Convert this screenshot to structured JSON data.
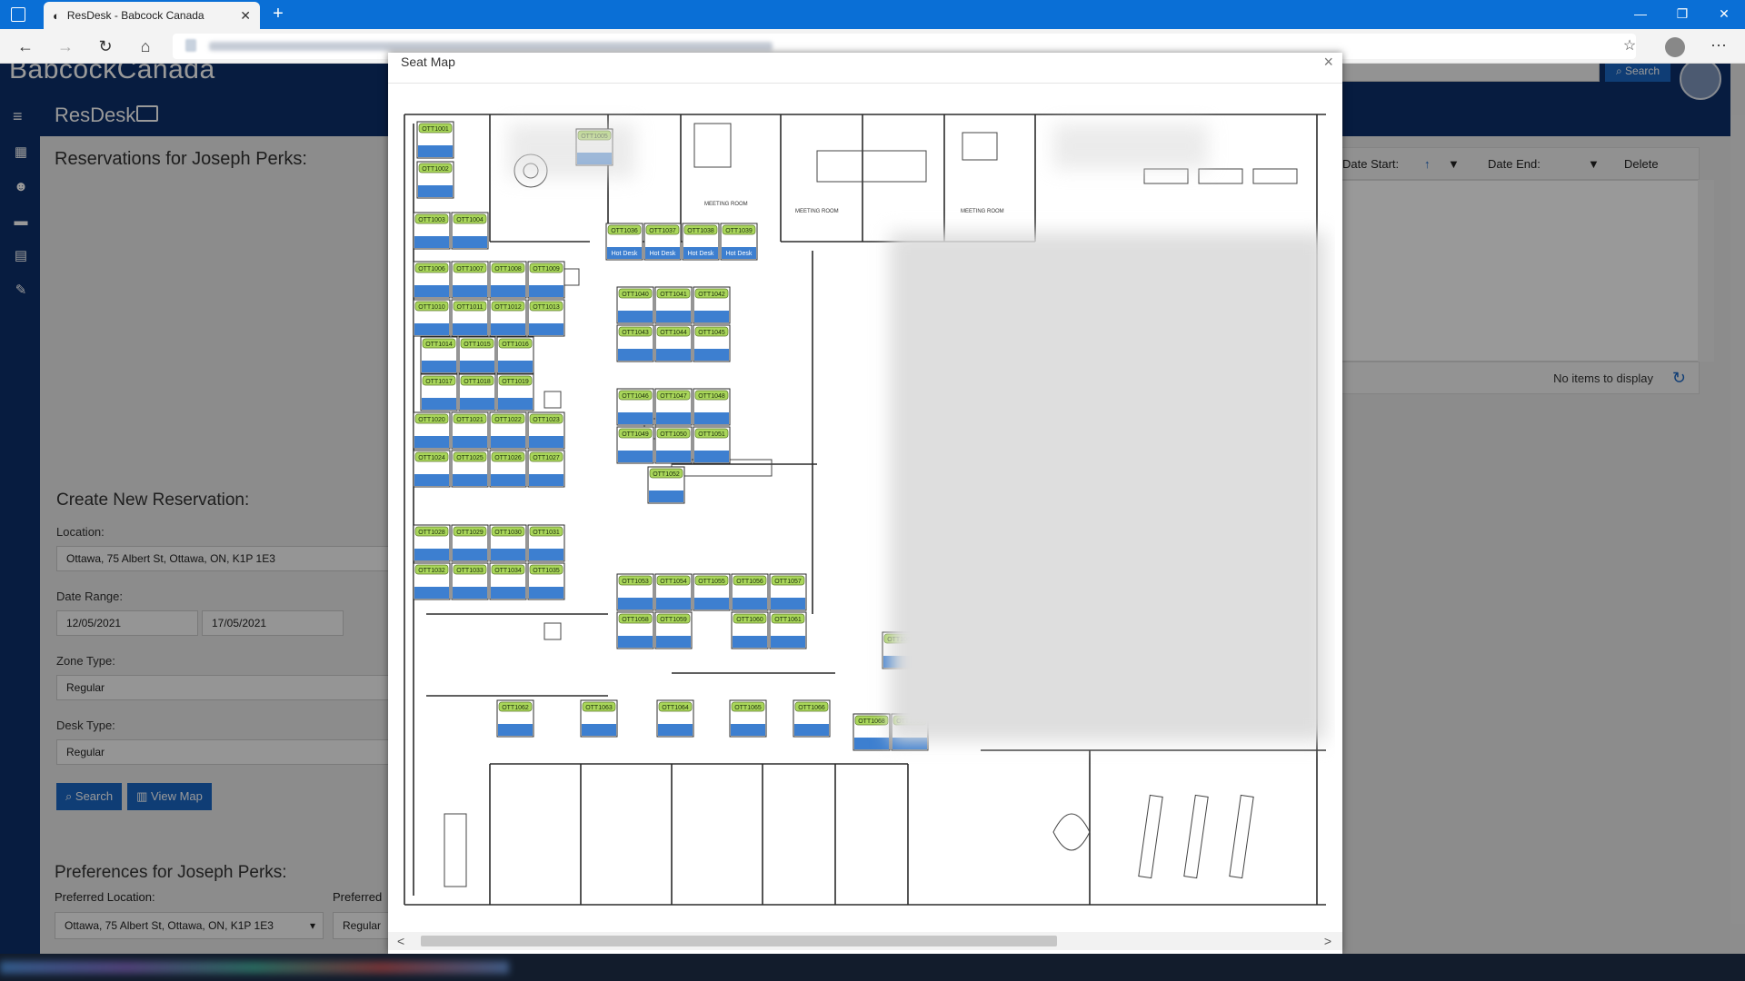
{
  "browser": {
    "tab_title": "ResDesk - Babcock Canada",
    "tab_close": "✕",
    "new_tab": "+",
    "controls": {
      "minimize": "—",
      "maximize": "❐",
      "close": "✕"
    },
    "nav": {
      "back": "←",
      "forward": "→",
      "refresh": "↻",
      "home": "⌂",
      "favorites": "☆",
      "more": "···"
    }
  },
  "app": {
    "brand": "BabcockCanada",
    "name": "ResDesk",
    "header_search_label": "Search",
    "sidebar_icons": [
      "calendar-icon",
      "user-settings-icon",
      "briefcase-icon",
      "map-icon",
      "edit-icon"
    ],
    "accent_color": "#0d2f6b"
  },
  "reservations": {
    "title": "Reservations for Joseph Perks:",
    "grid_columns": [
      "Date Start:",
      "Date End:",
      "Delete"
    ],
    "grid_empty_text": "No items to display"
  },
  "create": {
    "title": "Create New Reservation:",
    "location_label": "Location:",
    "location_value": "Ottawa, 75 Albert St, Ottawa, ON, K1P 1E3",
    "date_range_label": "Date Range:",
    "date_start": "12/05/2021",
    "date_end": "17/05/2021",
    "zone_type_label": "Zone Type:",
    "zone_type_value": "Regular",
    "desk_type_label": "Desk Type:",
    "desk_type_value": "Regular",
    "search_button": "Search",
    "view_map_button": "View Map"
  },
  "preferences": {
    "title": "Preferences for Joseph Perks:",
    "location_label": "Preferred Location:",
    "location_value": "Ottawa, 75 Albert St, Ottawa, ON, K1P 1E3",
    "desk_label": "Preferred",
    "desk_value": "Regular"
  },
  "modal": {
    "title": "Seat Map",
    "close": "×",
    "room_labels": [
      "MEETING ROOM",
      "MEETING ROOM",
      "MEETING ROOM"
    ],
    "seats": [
      {
        "id": "OTT1001",
        "label": ""
      },
      {
        "id": "OTT1002",
        "label": ""
      },
      {
        "id": "OTT1003",
        "label": ""
      },
      {
        "id": "OTT1004",
        "label": ""
      },
      {
        "id": "OTT1005",
        "label": ""
      },
      {
        "id": "OTT1006",
        "label": ""
      },
      {
        "id": "OTT1007",
        "label": ""
      },
      {
        "id": "OTT1008",
        "label": ""
      },
      {
        "id": "OTT1009",
        "label": ""
      },
      {
        "id": "OTT1010",
        "label": ""
      },
      {
        "id": "OTT1011",
        "label": ""
      },
      {
        "id": "OTT1012",
        "label": ""
      },
      {
        "id": "OTT1013",
        "label": ""
      },
      {
        "id": "OTT1014",
        "label": ""
      },
      {
        "id": "OTT1015",
        "label": ""
      },
      {
        "id": "OTT1016",
        "label": ""
      },
      {
        "id": "OTT1017",
        "label": ""
      },
      {
        "id": "OTT1018",
        "label": ""
      },
      {
        "id": "OTT1019",
        "label": ""
      },
      {
        "id": "OTT1020",
        "label": ""
      },
      {
        "id": "OTT1021",
        "label": ""
      },
      {
        "id": "OTT1022",
        "label": ""
      },
      {
        "id": "OTT1023",
        "label": ""
      },
      {
        "id": "OTT1024",
        "label": ""
      },
      {
        "id": "OTT1025",
        "label": ""
      },
      {
        "id": "OTT1026",
        "label": ""
      },
      {
        "id": "OTT1027",
        "label": ""
      },
      {
        "id": "OTT1028",
        "label": ""
      },
      {
        "id": "OTT1029",
        "label": ""
      },
      {
        "id": "OTT1030",
        "label": ""
      },
      {
        "id": "OTT1031",
        "label": ""
      },
      {
        "id": "OTT1032",
        "label": ""
      },
      {
        "id": "OTT1033",
        "label": ""
      },
      {
        "id": "OTT1034",
        "label": ""
      },
      {
        "id": "OTT1035",
        "label": ""
      },
      {
        "id": "OTT1036",
        "label": "Hot Desk"
      },
      {
        "id": "OTT1037",
        "label": "Hot Desk"
      },
      {
        "id": "OTT1038",
        "label": "Hot Desk"
      },
      {
        "id": "OTT1039",
        "label": "Hot Desk"
      },
      {
        "id": "OTT1040",
        "label": ""
      },
      {
        "id": "OTT1041",
        "label": ""
      },
      {
        "id": "OTT1042",
        "label": ""
      },
      {
        "id": "OTT1043",
        "label": ""
      },
      {
        "id": "OTT1044",
        "label": ""
      },
      {
        "id": "OTT1045",
        "label": ""
      },
      {
        "id": "OTT1046",
        "label": ""
      },
      {
        "id": "OTT1047",
        "label": ""
      },
      {
        "id": "OTT1048",
        "label": ""
      },
      {
        "id": "OTT1049",
        "label": ""
      },
      {
        "id": "OTT1050",
        "label": ""
      },
      {
        "id": "OTT1051",
        "label": ""
      },
      {
        "id": "OTT1052",
        "label": ""
      },
      {
        "id": "OTT1053",
        "label": ""
      },
      {
        "id": "OTT1054",
        "label": ""
      },
      {
        "id": "OTT1055",
        "label": ""
      },
      {
        "id": "OTT1056",
        "label": ""
      },
      {
        "id": "OTT1057",
        "label": ""
      },
      {
        "id": "OTT1058",
        "label": ""
      },
      {
        "id": "OTT1059",
        "label": ""
      },
      {
        "id": "OTT1060",
        "label": ""
      },
      {
        "id": "OTT1061",
        "label": ""
      },
      {
        "id": "OTT1062",
        "label": ""
      },
      {
        "id": "OTT1063",
        "label": ""
      },
      {
        "id": "OTT1064",
        "label": ""
      },
      {
        "id": "OTT1065",
        "label": ""
      },
      {
        "id": "OTT1066",
        "label": ""
      },
      {
        "id": "OTT1067",
        "label": ""
      },
      {
        "id": "OTT1068",
        "label": ""
      },
      {
        "id": "OTT1069",
        "label": ""
      }
    ],
    "scroll_left": "<",
    "scroll_right": ">"
  },
  "colors": {
    "seat_tag": "#a9d65a",
    "seat_bar": "#3d7fd0",
    "browser_bar": "#0a6fd6",
    "button_blue": "#1a66c4"
  }
}
